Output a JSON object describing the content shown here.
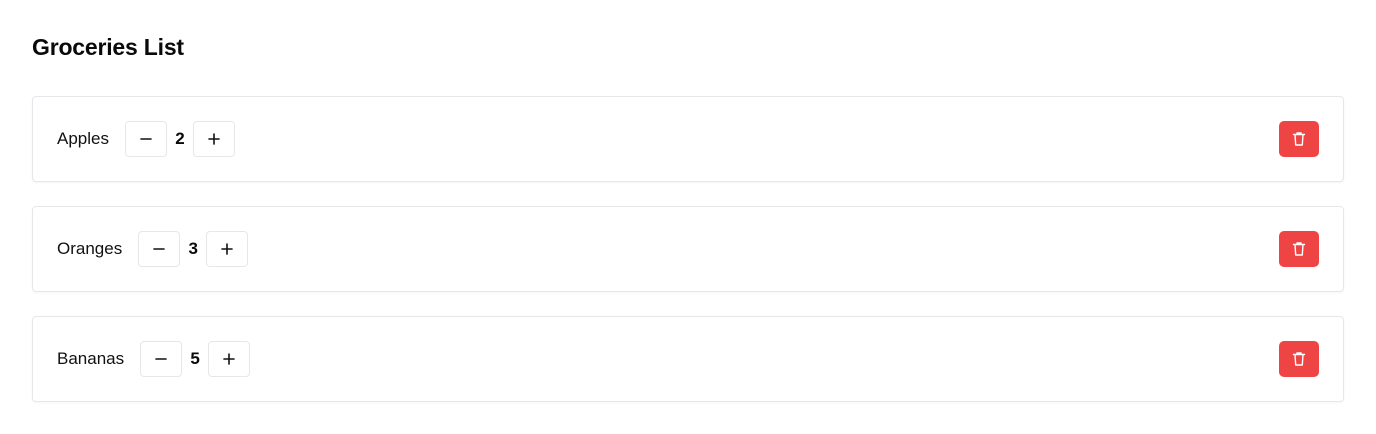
{
  "page": {
    "title": "Groceries List"
  },
  "items": [
    {
      "name": "Apples",
      "quantity": "2"
    },
    {
      "name": "Oranges",
      "quantity": "3"
    },
    {
      "name": "Bananas",
      "quantity": "5"
    }
  ],
  "icons": {
    "decrement": "minus-icon",
    "increment": "plus-icon",
    "delete": "trash-icon"
  },
  "colors": {
    "delete_button": "#ef4444",
    "card_border": "#e5e7eb",
    "text": "#111111"
  }
}
